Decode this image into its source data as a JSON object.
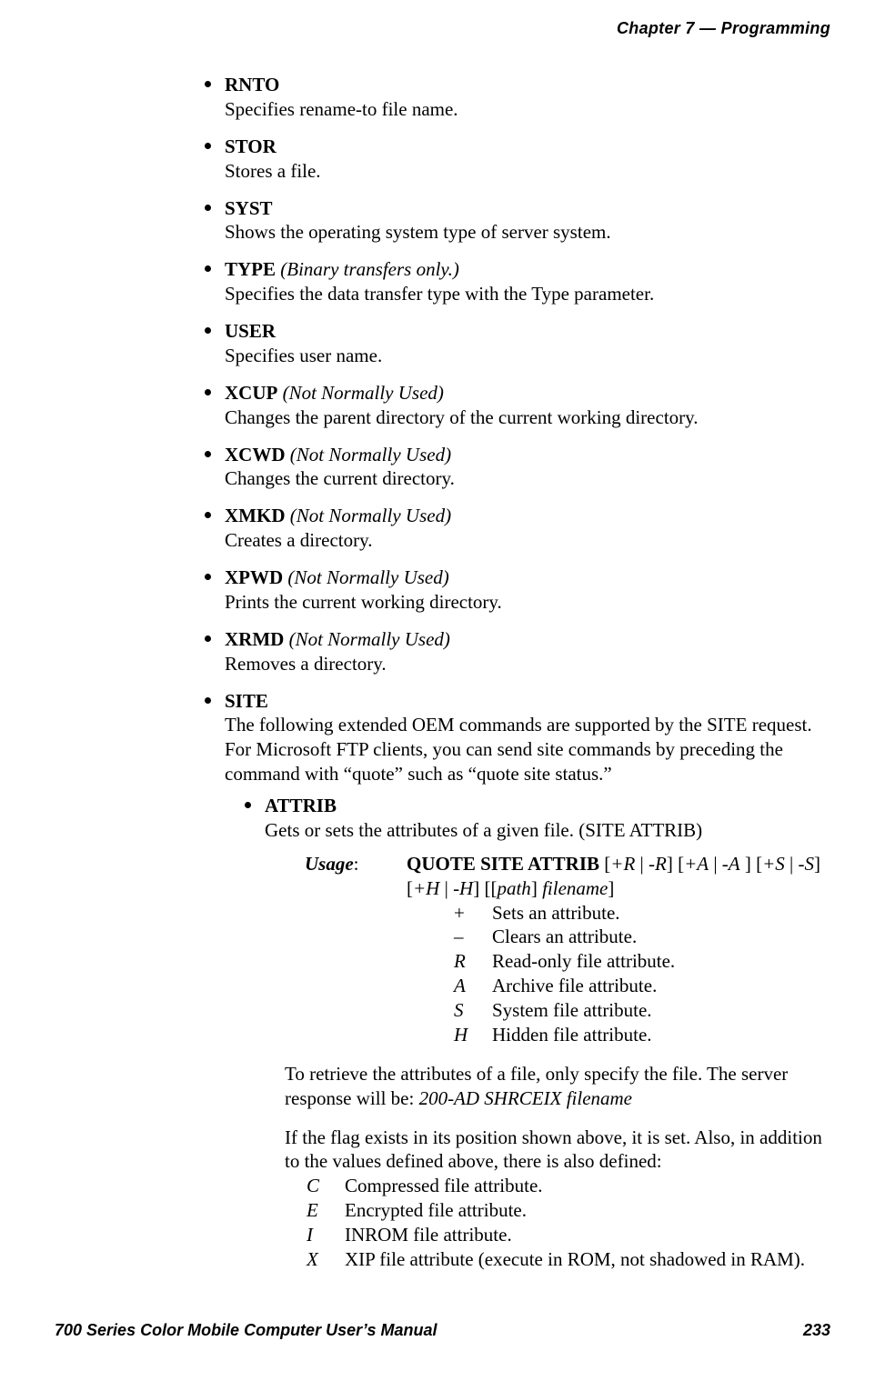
{
  "header": {
    "chapter_label": "Chapter",
    "chapter_num": "7",
    "dash": "—",
    "section": "Programming"
  },
  "cmds": [
    {
      "name": "RNTO",
      "note": "",
      "desc": "Specifies rename-to file name."
    },
    {
      "name": "STOR",
      "note": "",
      "desc": "Stores a file."
    },
    {
      "name": "SYST",
      "note": "",
      "desc": "Shows the operating system type of server system."
    },
    {
      "name": "TYPE",
      "note": "(Binary transfers only.)",
      "desc": "Specifies the data transfer type with the Type parameter."
    },
    {
      "name": "USER",
      "note": "",
      "desc": "Specifies user name."
    },
    {
      "name": "XCUP",
      "note": "(Not Normally Used)",
      "desc": "Changes the parent directory of the current working directory."
    },
    {
      "name": "XCWD",
      "note": "(Not Normally Used)",
      "desc": "Changes the current directory."
    },
    {
      "name": "XMKD",
      "note": "(Not Normally Used)",
      "desc": "Creates a directory."
    },
    {
      "name": "XPWD",
      "note": "(Not Normally Used)",
      "desc": "Prints the current working directory."
    },
    {
      "name": "XRMD",
      "note": "(Not Normally Used)",
      "desc": "Removes a directory."
    }
  ],
  "site": {
    "name": "SITE",
    "desc": "The following extended OEM commands are supported by the SITE request. For Microsoft FTP clients, you can send site commands by preceding the command with “quote” such as “quote site status.”"
  },
  "attrib": {
    "name": "ATTRIB",
    "desc": "Gets or sets the attributes of a given file. (SITE ATTRIB)",
    "usage_label": "Usage",
    "usage_cmd": "QUOTE SITE ATTRIB",
    "usage_args_a": "[+R | -R] [+A | -A ] [+S | -S]",
    "usage_args_b": "[+H | -H] [[path] filename]",
    "usage_args_b_plain1": "[",
    "usage_args_b_it1": "+H",
    "usage_args_b_plain2": " | ",
    "usage_args_b_it2": "-H",
    "usage_args_b_plain3": "] [[",
    "usage_args_b_it3": "path",
    "usage_args_b_plain4": "] ",
    "usage_args_b_it4": "filename",
    "usage_args_b_plain5": "]",
    "flags": [
      {
        "k": "+",
        "d": "Sets an attribute."
      },
      {
        "k": "–",
        "d": "Clears an attribute."
      },
      {
        "k": "R",
        "d": "Read-only file attribute."
      },
      {
        "k": "A",
        "d": "Archive file attribute."
      },
      {
        "k": "S",
        "d": "System file attribute."
      },
      {
        "k": "H",
        "d": "Hidden file attribute."
      }
    ],
    "retrieve_a": "To retrieve the attributes of a file, only specify the file. The server response will be: ",
    "retrieve_b": "200-AD SHRCEIX filename",
    "also_defined": "If the flag exists in its position shown above, it is set. Also, in addition to the values defined above, there is also defined:",
    "flags2": [
      {
        "k": "C",
        "d": "Compressed file attribute."
      },
      {
        "k": "E",
        "d": "Encrypted file attribute."
      },
      {
        "k": "I",
        "d": "INROM file attribute."
      },
      {
        "k": "X",
        "d": "XIP file attribute (execute in ROM, not shadowed in RAM)."
      }
    ]
  },
  "footer": {
    "left": "700 Series Color Mobile Computer User’s Manual",
    "right": "233"
  }
}
